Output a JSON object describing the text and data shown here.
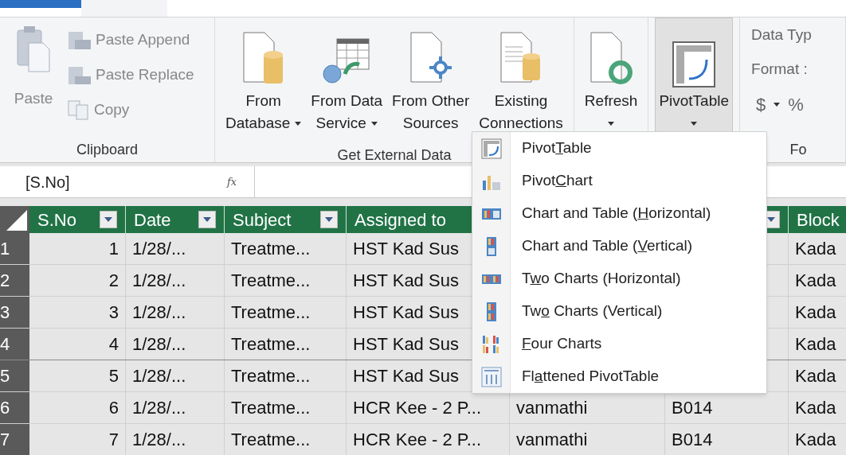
{
  "ribbon": {
    "groups": [
      {
        "label": "Clipboard",
        "kind": "clipboard",
        "buttons": [
          {
            "kind": "paste",
            "lines": [
              "Paste"
            ],
            "disabled": true
          },
          {
            "kind": "append",
            "lines": [
              "Paste Append"
            ],
            "disabled": true
          },
          {
            "kind": "replace",
            "lines": [
              "Paste Replace"
            ],
            "disabled": true
          },
          {
            "kind": "copy",
            "lines": [
              "Copy"
            ],
            "disabled": true
          }
        ]
      },
      {
        "label": "Get External Data",
        "kind": "large",
        "buttons": [
          {
            "kind": "database",
            "lines": [
              "From",
              "Database"
            ],
            "dropdown": true,
            "disabled": false,
            "selected": false
          },
          {
            "kind": "service",
            "lines": [
              "From Data",
              "Service"
            ],
            "dropdown": true,
            "disabled": false,
            "selected": false
          },
          {
            "kind": "other",
            "lines": [
              "From Other",
              "Sources"
            ],
            "dropdown": false,
            "disabled": false,
            "selected": false
          },
          {
            "kind": "connections",
            "lines": [
              "Existing",
              "Connections"
            ],
            "dropdown": false,
            "disabled": false,
            "selected": false
          }
        ]
      },
      {
        "kind": "large",
        "buttons": [
          {
            "kind": "refresh",
            "lines": [
              "Refresh"
            ],
            "dropdown": true,
            "disabled": false,
            "selected": false
          }
        ]
      },
      {
        "kind": "large",
        "buttons": [
          {
            "kind": "pivot",
            "lines": [
              "PivotTable"
            ],
            "dropdown": true,
            "disabled": false,
            "selected": true
          }
        ]
      },
      {
        "label": "Fo",
        "kind": "format",
        "lines": [
          "Data Typ",
          "Format :"
        ],
        "symbols": [
          "$",
          "%"
        ]
      }
    ]
  },
  "formula_bar": {
    "name_box": "[S.No]",
    "function_label": "fx"
  },
  "table": {
    "columns": [
      {
        "label": "S.No",
        "filter": true
      },
      {
        "label": "Date",
        "filter": true
      },
      {
        "label": "Subject",
        "filter": true
      },
      {
        "label": "Assigned to"
      },
      {},
      {
        "filter": true
      },
      {
        "label": "Block"
      }
    ],
    "rows": [
      {
        "number": "1",
        "cells": [
          "1",
          "1/28/...",
          "Treatme...",
          "HST Kad Sus",
          null,
          null,
          "Kada"
        ]
      },
      {
        "number": "2",
        "cells": [
          "2",
          "1/28/...",
          "Treatme...",
          "HST Kad Sus",
          null,
          null,
          "Kada"
        ]
      },
      {
        "number": "3",
        "cells": [
          "3",
          "1/28/...",
          "Treatme...",
          "HST Kad Sus",
          null,
          null,
          "Kada"
        ]
      },
      {
        "number": "4",
        "cells": [
          "4",
          "1/28/...",
          "Treatme...",
          "HST Kad Sus",
          null,
          null,
          "Kada"
        ]
      },
      {
        "number": "5",
        "cells": [
          "5",
          "1/28/...",
          "Treatme...",
          "HST Kad Sus",
          null,
          null,
          "Kada"
        ]
      },
      {
        "number": "6",
        "cells": [
          "6",
          "1/28/...",
          "Treatme...",
          "HCR Kee - 2 P...",
          "vanmathi",
          "B014",
          "Kada"
        ]
      },
      {
        "number": "7",
        "cells": [
          "7",
          "1/28/...",
          "Treatme...",
          "HCR Kee - 2 P...",
          "vanmathi",
          "B014",
          "Kada"
        ]
      }
    ]
  },
  "pivot_menu": {
    "items": [
      {
        "kind": "table",
        "before": "Pivot",
        "key": "T",
        "after": "able"
      },
      {
        "kind": "chart",
        "before": "Pivot",
        "key": "C",
        "after": "hart"
      },
      {
        "kind": "ctH",
        "before": "Chart and Table (",
        "key": "H",
        "after": "orizontal)"
      },
      {
        "kind": "ctV",
        "before": "Chart and Table (",
        "key": "V",
        "after": "ertical)"
      },
      {
        "kind": "twoH",
        "before": "T",
        "key": "w",
        "after": "o Charts (Horizontal)"
      },
      {
        "kind": "twoV",
        "before": "Tw",
        "key": "o",
        "after": " Charts (Vertical)"
      },
      {
        "kind": "four",
        "key": "F",
        "after": "our Charts"
      },
      {
        "kind": "flat",
        "before": "Fl",
        "key": "a",
        "after": "ttened PivotTable"
      }
    ]
  }
}
